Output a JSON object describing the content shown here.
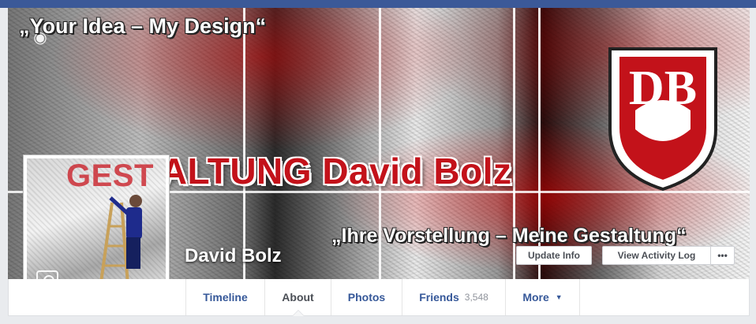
{
  "cover": {
    "tagline_top": "„Your Idea – My Design“",
    "brand_text": "GESTALTUNG David Bolz",
    "tagline_bottom": "„Ihre Vorstellung – Meine Gestaltung“",
    "logo_letters": "DB",
    "accent_red": "#c3121a",
    "camera_icon": "camera-icon"
  },
  "profile": {
    "name": "David Bolz",
    "picture_text": "GEST",
    "camera_icon": "camera-icon"
  },
  "actions": {
    "update_info": "Update Info",
    "view_activity_log": "View Activity Log",
    "more": "•••"
  },
  "tabs": [
    {
      "label": "Timeline",
      "active": false
    },
    {
      "label": "About",
      "active": true
    },
    {
      "label": "Photos",
      "active": false
    },
    {
      "label": "Friends",
      "count": "3,548",
      "active": false
    },
    {
      "label": "More",
      "chevron": "▼",
      "active": false
    }
  ],
  "colors": {
    "facebook_blue": "#3b5998",
    "link_blue": "#365899",
    "text_dark": "#4b4f56",
    "muted": "#90949c"
  }
}
